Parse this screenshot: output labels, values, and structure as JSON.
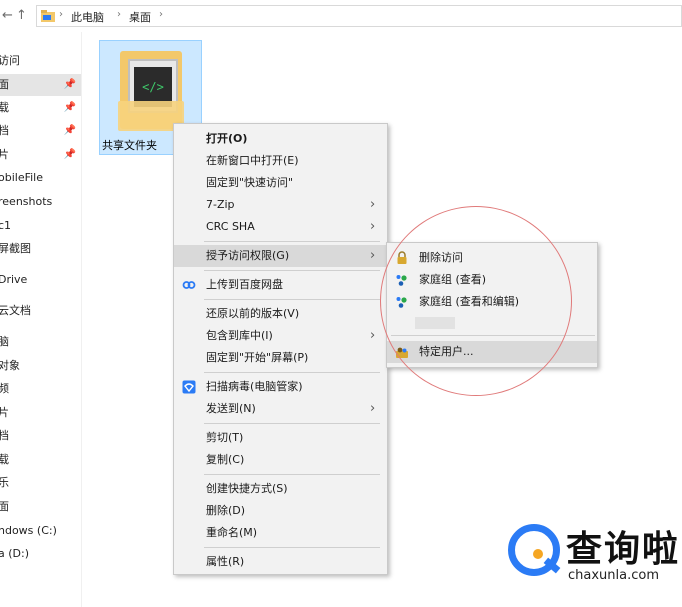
{
  "address_bar": {
    "back_icon": "back-arrow-icon",
    "up_icon": "up-arrow-icon",
    "crumbs": [
      "此电脑",
      "桌面"
    ]
  },
  "nav_pane": {
    "items": [
      {
        "label": "访问",
        "pinned": false
      },
      {
        "label": "面",
        "pinned": true,
        "selected": true
      },
      {
        "label": "载",
        "pinned": true
      },
      {
        "label": "档",
        "pinned": true
      },
      {
        "label": "片",
        "pinned": true
      },
      {
        "label": "obileFile",
        "pinned": false
      },
      {
        "label": "reenshots",
        "pinned": false
      },
      {
        "label": "c1",
        "pinned": false
      },
      {
        "label": "屏截图",
        "pinned": false
      },
      {
        "label": "Drive",
        "pinned": false
      },
      {
        "label": "云文档",
        "pinned": false
      },
      {
        "label": "脑",
        "pinned": false
      },
      {
        "label": "对象",
        "pinned": false
      },
      {
        "label": "频",
        "pinned": false
      },
      {
        "label": "片",
        "pinned": false
      },
      {
        "label": "档",
        "pinned": false
      },
      {
        "label": "载",
        "pinned": false
      },
      {
        "label": "乐",
        "pinned": false
      },
      {
        "label": "面",
        "pinned": false
      },
      {
        "label": "ndows (C:)",
        "pinned": false
      },
      {
        "label": "a (D:)",
        "pinned": false
      }
    ]
  },
  "desktop": {
    "folder_label": "共享文件夹",
    "folder_glyph": "</>"
  },
  "context_menu": {
    "items": [
      {
        "label": "打开(O)",
        "bold": true
      },
      {
        "label": "在新窗口中打开(E)"
      },
      {
        "label": "固定到\"快速访问\""
      },
      {
        "label": "7-Zip",
        "submenu": true
      },
      {
        "label": "CRC SHA",
        "submenu": true
      },
      {
        "label": "授予访问权限(G)",
        "submenu": true,
        "highlighted": true
      },
      {
        "label": "上传到百度网盘",
        "icon": "baidu-netdisk-icon"
      },
      {
        "label": "还原以前的版本(V)"
      },
      {
        "label": "包含到库中(I)",
        "submenu": true
      },
      {
        "label": "固定到\"开始\"屏幕(P)"
      },
      {
        "label": "扫描病毒(电脑管家)",
        "icon": "shield-scan-icon"
      },
      {
        "label": "发送到(N)",
        "submenu": true
      },
      {
        "label": "剪切(T)"
      },
      {
        "label": "复制(C)"
      },
      {
        "label": "创建快捷方式(S)"
      },
      {
        "label": "删除(D)"
      },
      {
        "label": "重命名(M)"
      },
      {
        "label": "属性(R)"
      }
    ]
  },
  "submenu": {
    "items": [
      {
        "label": "删除访问",
        "icon": "lock-icon"
      },
      {
        "label": "家庭组 (查看)",
        "icon": "homegroup-icon"
      },
      {
        "label": "家庭组 (查看和编辑)",
        "icon": "homegroup-icon"
      },
      {
        "label": "特定用户...",
        "icon": "users-icon",
        "highlighted": true
      }
    ]
  },
  "watermark": {
    "name": "查询啦",
    "domain": "chaxunla.com"
  },
  "colors": {
    "selection_blue": "#cce8ff",
    "menu_bg": "#f2f2f2",
    "annotation_red": "#e07a7a",
    "brand_blue": "#2b7bf5",
    "brand_orange": "#f5a623"
  }
}
